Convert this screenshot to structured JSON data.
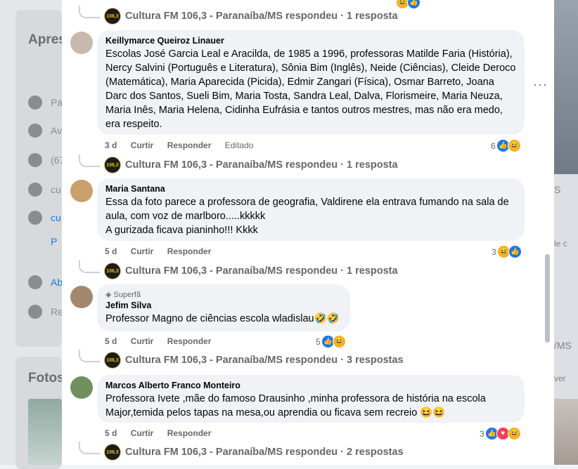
{
  "left_panel": {
    "title_intro": "Apres",
    "side_rows": [
      "Pá",
      "Av",
      "(67",
      "cu",
      "cu",
      "P",
      "Ab",
      "Re"
    ],
    "title_photos": "Fotos"
  },
  "right_panel": {
    "texts": [
      "S",
      "le c",
      "/MS",
      "ver"
    ]
  },
  "comments": [
    {
      "author": "Keillymarce Queiroz Linauer",
      "text": "Escolas José Garcia Leal e Aracilda, de 1985 a 1996, professoras Matilde Faria (História), Nercy Salvini (Português e Literatura), Sônia Bim (Inglês), Neide (Ciências), Cleide Deroco (Matemática), Maria Aparecida (Picida), Edmir Zangari (Física), Osmar Barreto, Joana Darc dos Santos, Sueli Bim, Maria Tosta, Sandra Leal, Dalva, Florismeire, Maria Neuza, Maria Inês, Maria Helena, Cidinha Eufrásia e tantos outros mestres, mas não era medo, era respeito.",
      "time": "3 d",
      "like": "Curtir",
      "reply": "Responder",
      "edited": "Editado",
      "reaction_count": "6",
      "page_reply": "Cultura FM 106,3 - Paranaíba/MS respondeu · 1 resposta"
    },
    {
      "author": "Maria Santana",
      "text": "Essa da foto parece a professora de geografia, Valdirene ela entrava fumando na sala de aula, com voz de marlboro.....kkkkk\nA gurizada ficava pianinho!!! Kkkk",
      "time": "5 d",
      "like": "Curtir",
      "reply": "Responder",
      "reaction_count": "3",
      "page_reply": "Cultura FM 106,3 - Paranaíba/MS respondeu · 1 resposta"
    },
    {
      "badge": "Superfã",
      "author": "Jefim Silva",
      "text": "Professor Magno de ciências escola wladislau🤣🤣",
      "time": "5 d",
      "like": "Curtir",
      "reply": "Responder",
      "reaction_count": "5",
      "page_reply": "Cultura FM 106,3 - Paranaíba/MS respondeu · 3 respostas"
    },
    {
      "author": "Marcos Alberto Franco Monteiro",
      "text": "Professora Ivete ,mãe do famoso Drausinho ,minha professora de história na escola Major,temida pelos tapas na mesa,ou aprendia ou ficava sem recreio 😆😆",
      "time": "5 d",
      "like": "Curtir",
      "reply": "Responder",
      "reaction_count": "3",
      "page_reply": "Cultura FM 106,3 - Paranaíba/MS respondeu · 2 respostas"
    }
  ],
  "top_reply": "Cultura FM 106,3 - Paranaíba/MS respondeu · 1 resposta",
  "page_avatar_text": "106,3",
  "more_label": "···",
  "icons": {
    "like": "like-icon",
    "haha": "haha-icon",
    "love": "love-icon",
    "badge": "diamond-icon"
  },
  "colors": {
    "like": "#1877f2",
    "haha": "#f7b125",
    "love": "#f33e58"
  }
}
